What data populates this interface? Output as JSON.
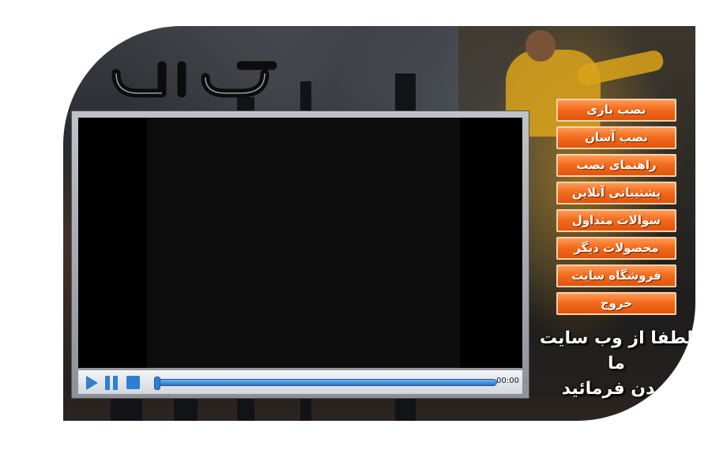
{
  "app": {
    "logo_text": "ویژن"
  },
  "player": {
    "time": "00:00",
    "progress": 0,
    "controls": [
      "play-icon",
      "pause-icon",
      "stop-icon"
    ]
  },
  "menu": {
    "items": [
      {
        "label": "نصب بازی"
      },
      {
        "label": "نصب آسان"
      },
      {
        "label": "راهنمای نصب"
      },
      {
        "label": "پشتیبانی آنلاین"
      },
      {
        "label": "سوالات متداول"
      },
      {
        "label": "محصولات دیگر"
      },
      {
        "label": "فروشگاه سایت"
      },
      {
        "label": "خروج"
      }
    ]
  },
  "notice": {
    "line1": "لطفا از وب سایت ما",
    "line2": "دیدن فرمائید"
  },
  "colors": {
    "button_orange": "#f26c1e",
    "player_blue": "#2f7fd0"
  }
}
